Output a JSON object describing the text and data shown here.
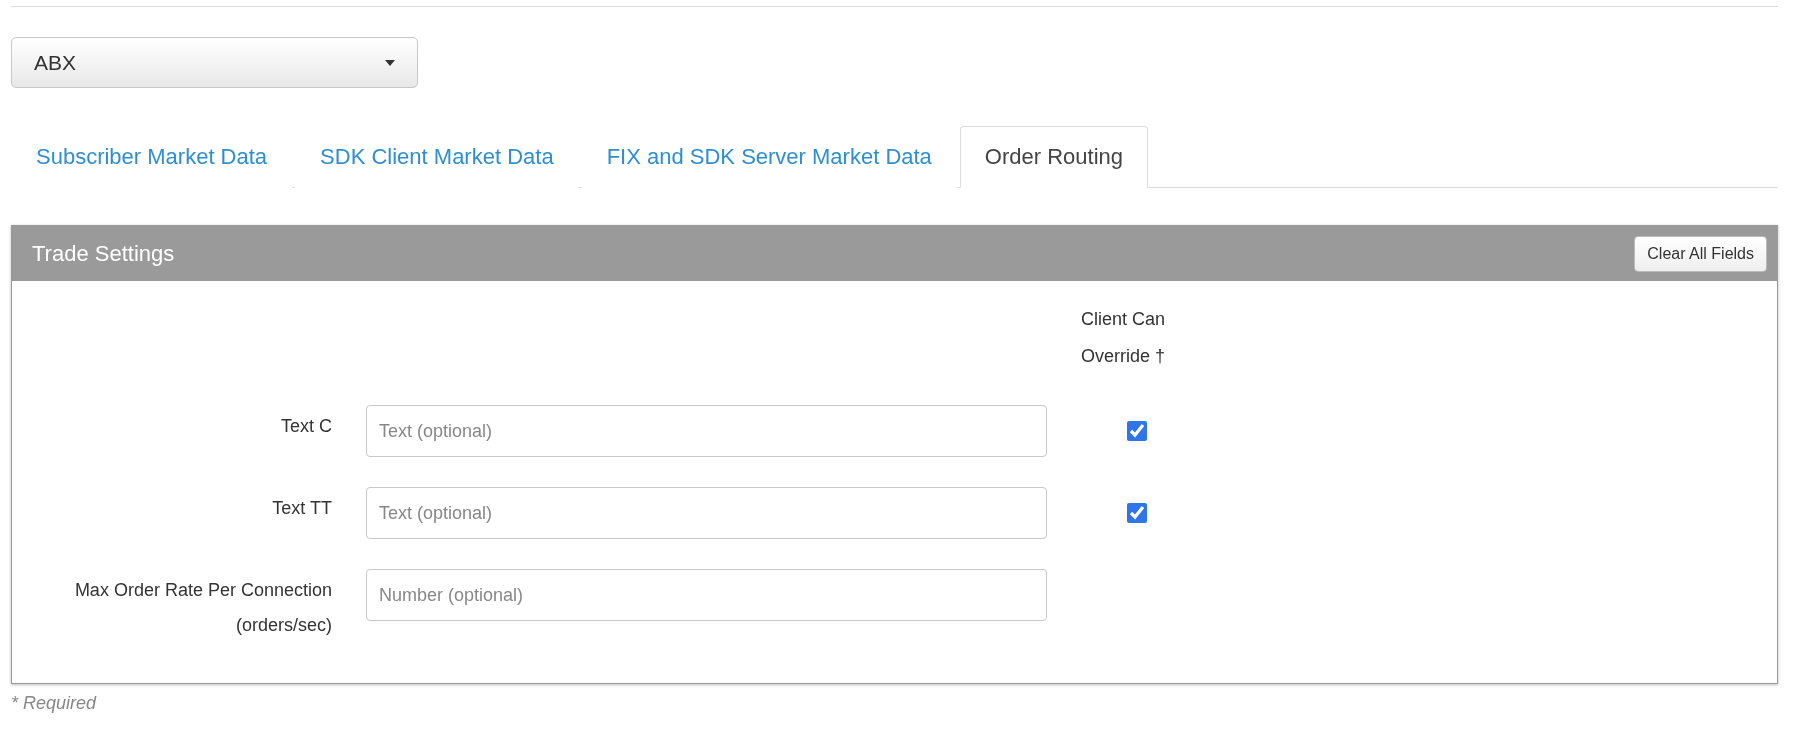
{
  "exchange_select": {
    "value": "ABX"
  },
  "tabs": [
    {
      "label": "Subscriber Market Data",
      "selected": false
    },
    {
      "label": "SDK Client Market Data",
      "selected": false
    },
    {
      "label": "FIX and SDK Server Market Data",
      "selected": false
    },
    {
      "label": "Order Routing",
      "selected": true
    }
  ],
  "panel": {
    "title": "Trade Settings",
    "clear_button": "Clear All Fields",
    "override_heading": "Client Can Override †",
    "rows": [
      {
        "label": "Text C",
        "placeholder": "Text (optional)",
        "kind": "checkbox",
        "checked": true
      },
      {
        "label": "Text TT",
        "placeholder": "Text (optional)",
        "kind": "checkbox",
        "checked": true
      },
      {
        "label": "Max Order Rate Per Connection (orders/sec)",
        "placeholder": "Number (optional)",
        "kind": "plain"
      }
    ]
  },
  "footnote": "* Required"
}
